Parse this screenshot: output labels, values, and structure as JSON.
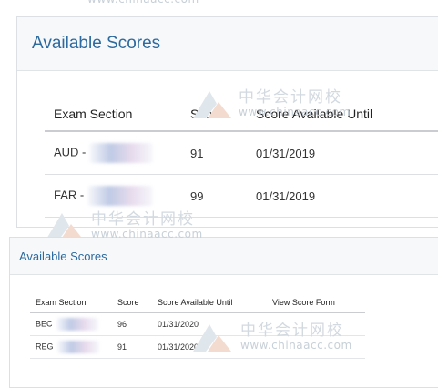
{
  "watermark": {
    "cn": "中华会计网校",
    "en": "www.chinaacc.com"
  },
  "panel_top": {
    "title": "Available Scores",
    "columns": [
      "Exam Section",
      "Score",
      "Score Available Until"
    ],
    "rows": [
      {
        "section": "AUD -",
        "score": "91",
        "until": "01/31/2019"
      },
      {
        "section": "FAR -",
        "score": "99",
        "until": "01/31/2019"
      }
    ]
  },
  "panel_bottom": {
    "title": "Available Scores",
    "columns": [
      "Exam Section",
      "Score",
      "Score Available Until",
      "View Score Form"
    ],
    "rows": [
      {
        "section": "BEC",
        "score": "96",
        "until": "01/31/2020"
      },
      {
        "section": "REG",
        "score": "91",
        "until": "01/31/2020"
      }
    ]
  }
}
